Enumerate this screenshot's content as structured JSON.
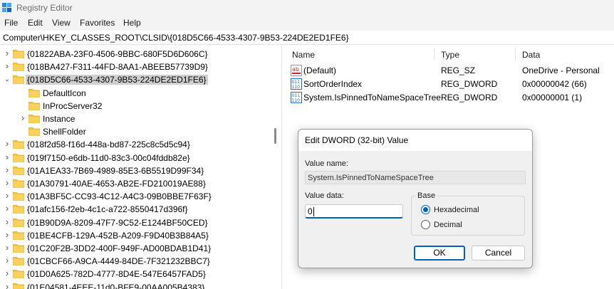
{
  "window": {
    "title": "Registry Editor"
  },
  "menu": [
    "File",
    "Edit",
    "View",
    "Favorites",
    "Help"
  ],
  "address": "Computer\\HKEY_CLASSES_ROOT\\CLSID\\{018D5C66-4533-4307-9B53-224DE2ED1FE6}",
  "tree": [
    {
      "label": "{01822ABA-23F0-4506-9BBC-680F5D6D606C}",
      "level": 0,
      "chevron": "right",
      "selected": false
    },
    {
      "label": "{018BA427-F311-44FD-8AA1-ABEEB57739D9}",
      "level": 0,
      "chevron": "right",
      "selected": false
    },
    {
      "label": "{018D5C66-4533-4307-9B53-224DE2ED1FE6}",
      "level": 0,
      "chevron": "down",
      "selected": true
    },
    {
      "label": "DefaultIcon",
      "level": 1,
      "chevron": "none",
      "selected": false
    },
    {
      "label": "InProcServer32",
      "level": 1,
      "chevron": "none",
      "selected": false
    },
    {
      "label": "Instance",
      "level": 1,
      "chevron": "right",
      "selected": false
    },
    {
      "label": "ShellFolder",
      "level": 1,
      "chevron": "none",
      "selected": false
    },
    {
      "label": "{018f2d58-f16d-448a-bd87-225c8c5d5c94}",
      "level": 0,
      "chevron": "right",
      "selected": false
    },
    {
      "label": "{019f7150-e6db-11d0-83c3-00c04fddb82e}",
      "level": 0,
      "chevron": "right",
      "selected": false
    },
    {
      "label": "{01A1EA33-7B69-4989-85E3-6B5519D99F34}",
      "level": 0,
      "chevron": "right",
      "selected": false
    },
    {
      "label": "{01A30791-40AE-4653-AB2E-FD210019AE88}",
      "level": 0,
      "chevron": "right",
      "selected": false
    },
    {
      "label": "{01A3BF5C-CC93-4C12-A4C3-09B0BBE7F63F}",
      "level": 0,
      "chevron": "right",
      "selected": false
    },
    {
      "label": "{01afc156-f2eb-4c1c-a722-8550417d396f}",
      "level": 0,
      "chevron": "right",
      "selected": false
    },
    {
      "label": "{01B90D9A-8209-47F7-9C52-E1244BF50CED}",
      "level": 0,
      "chevron": "right",
      "selected": false
    },
    {
      "label": "{01BE4CFB-129A-452B-A209-F9D40B3B84A5}",
      "level": 0,
      "chevron": "right",
      "selected": false
    },
    {
      "label": "{01C20F2B-3DD2-400F-949F-AD00BDAB1D41}",
      "level": 0,
      "chevron": "right",
      "selected": false
    },
    {
      "label": "{01CBCF66-A9CA-4449-84DE-7F321232BBC7}",
      "level": 0,
      "chevron": "right",
      "selected": false
    },
    {
      "label": "{01D0A625-782D-4777-8D4E-547E6457FAD5}",
      "level": 0,
      "chevron": "right",
      "selected": false
    },
    {
      "label": "{01E04581-4EEE-11d0-BFE9-00AA005B4383}",
      "level": 0,
      "chevron": "right",
      "selected": false
    }
  ],
  "list": {
    "headers": {
      "name": "Name",
      "type": "Type",
      "data": "Data"
    },
    "rows": [
      {
        "name": "(Default)",
        "type": "REG_SZ",
        "data": "OneDrive - Personal",
        "icon": "string-value-icon"
      },
      {
        "name": "SortOrderIndex",
        "type": "REG_DWORD",
        "data": "0x00000042 (66)",
        "icon": "binary-value-icon"
      },
      {
        "name": "System.IsPinnedToNameSpaceTree",
        "type": "REG_DWORD",
        "data": "0x00000001 (1)",
        "icon": "binary-value-icon"
      }
    ]
  },
  "dialog": {
    "title": "Edit DWORD (32-bit) Value",
    "value_name_label": "Value name:",
    "value_name": "System.IsPinnedToNameSpaceTree",
    "value_data_label": "Value data:",
    "value_data": "0",
    "base_label": "Base",
    "hex_label": "Hexadecimal",
    "dec_label": "Decimal",
    "selected_base": "hex",
    "ok_label": "OK",
    "cancel_label": "Cancel"
  },
  "colors": {
    "accent": "#005fb8",
    "folder": "#f5c542",
    "selection": "#cfcfcf"
  }
}
